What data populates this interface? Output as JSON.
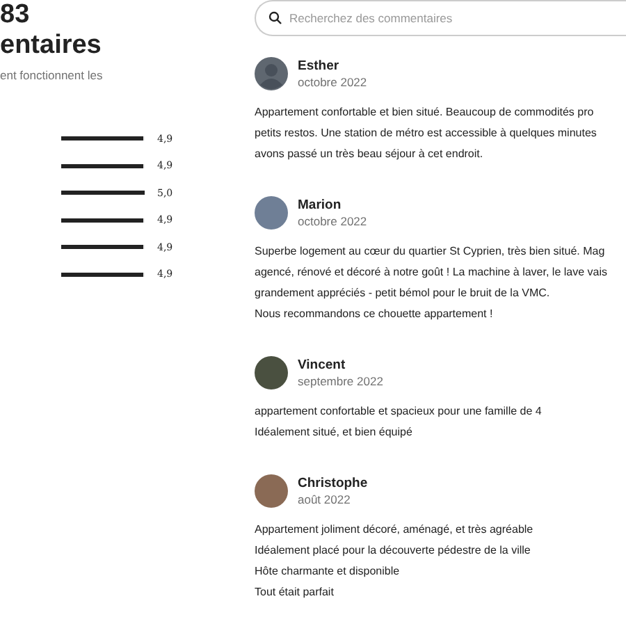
{
  "summary": {
    "count": "83",
    "title": "entaires",
    "subtitle": "ent fonctionnent les"
  },
  "ratings": [
    {
      "level": 0.98,
      "reading": "4,9"
    },
    {
      "level": 0.98,
      "reading": "4,9"
    },
    {
      "level": 1,
      "reading": "5,0"
    },
    {
      "level": 0.98,
      "reading": "4,9"
    },
    {
      "level": 0.98,
      "reading": "4,9"
    },
    {
      "level": 0.98,
      "reading": "4,9"
    }
  ],
  "search": {
    "placeholder": "Recherchez des commentaires"
  },
  "reviews": [
    {
      "name": "Esther",
      "date": "octobre 2022",
      "has_photo": false,
      "lines": [
        "Appartement confortable et bien situé. Beaucoup de commodités pro",
        "petits restos. Une station de métro est accessible à quelques minutes",
        "avons passé un très beau séjour à cet endroit."
      ]
    },
    {
      "name": "Marion",
      "date": "octobre 2022",
      "has_photo": true,
      "lines": [
        "Superbe logement au cœur du quartier St Cyprien, très bien situé. Mag",
        "agencé, rénové et décoré à notre goût ! La machine à laver, le lave vais",
        "grandement appréciés - petit bémol pour le bruit de la VMC.",
        "Nous recommandons ce chouette appartement !"
      ]
    },
    {
      "name": "Vincent",
      "date": "septembre 2022",
      "has_photo": true,
      "lines": [
        "appartement confortable et spacieux pour une famille de 4",
        "Idéalement situé, et bien équipé"
      ]
    },
    {
      "name": "Christophe",
      "date": "août 2022",
      "has_photo": true,
      "lines": [
        "Appartement joliment décoré, aménagé, et très agréable",
        "Idéalement placé pour la découverte pédestre de la ville",
        "Hôte charmante et disponible",
        "Tout était parfait"
      ]
    }
  ]
}
